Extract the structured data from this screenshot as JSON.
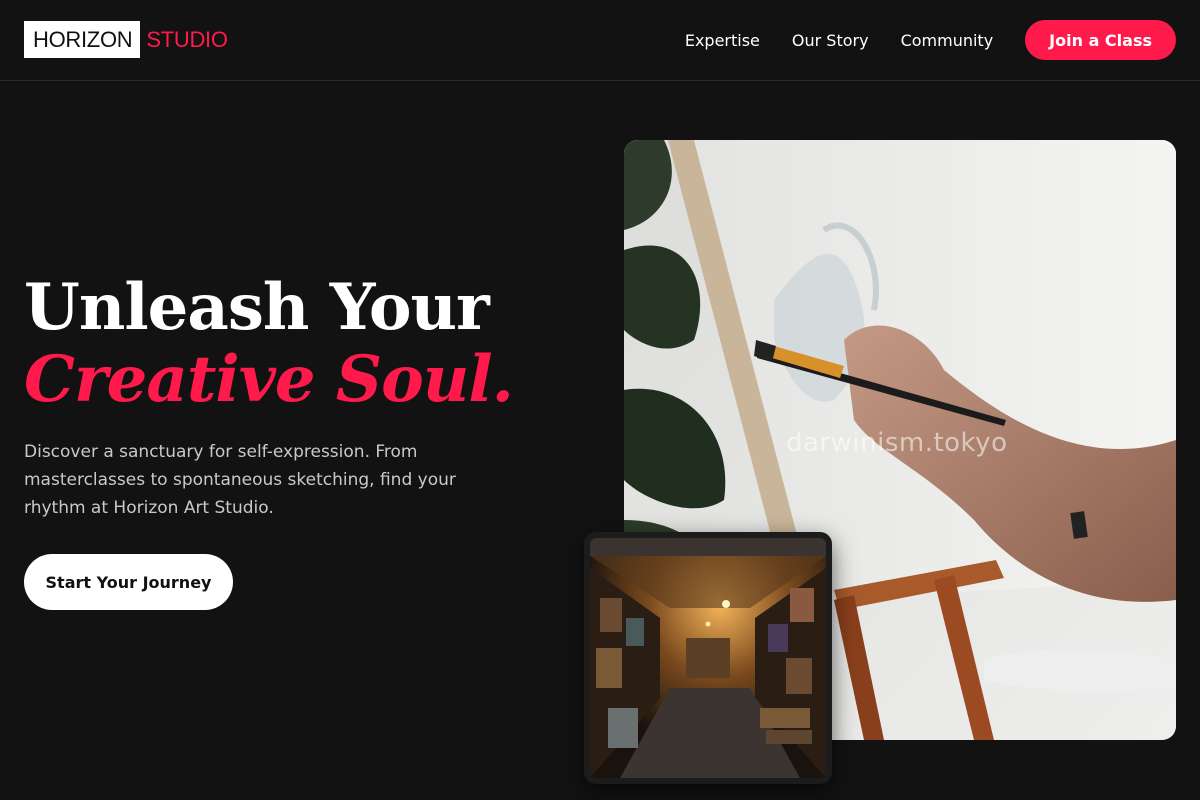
{
  "header": {
    "logo_primary": "HORIZON",
    "logo_secondary": "STUDIO",
    "nav": [
      {
        "label": "Expertise"
      },
      {
        "label": "Our Story"
      },
      {
        "label": "Community"
      }
    ],
    "cta_label": "Join a Class"
  },
  "hero": {
    "title_line1": "Unleash Your",
    "title_line2": "Creative Soul.",
    "description": "Discover a sanctuary for self-expression. From masterclasses to spontaneous sketching, find your rhythm at Horizon Art Studio.",
    "button_label": "Start Your Journey"
  },
  "images": {
    "main_alt": "painting-at-easel-photo",
    "inset_alt": "art-storage-room-photo",
    "watermark": "darwinism.tokyo"
  },
  "colors": {
    "accent": "#ff1a4b",
    "background": "#121212",
    "text_muted": "#c9c9c9"
  }
}
